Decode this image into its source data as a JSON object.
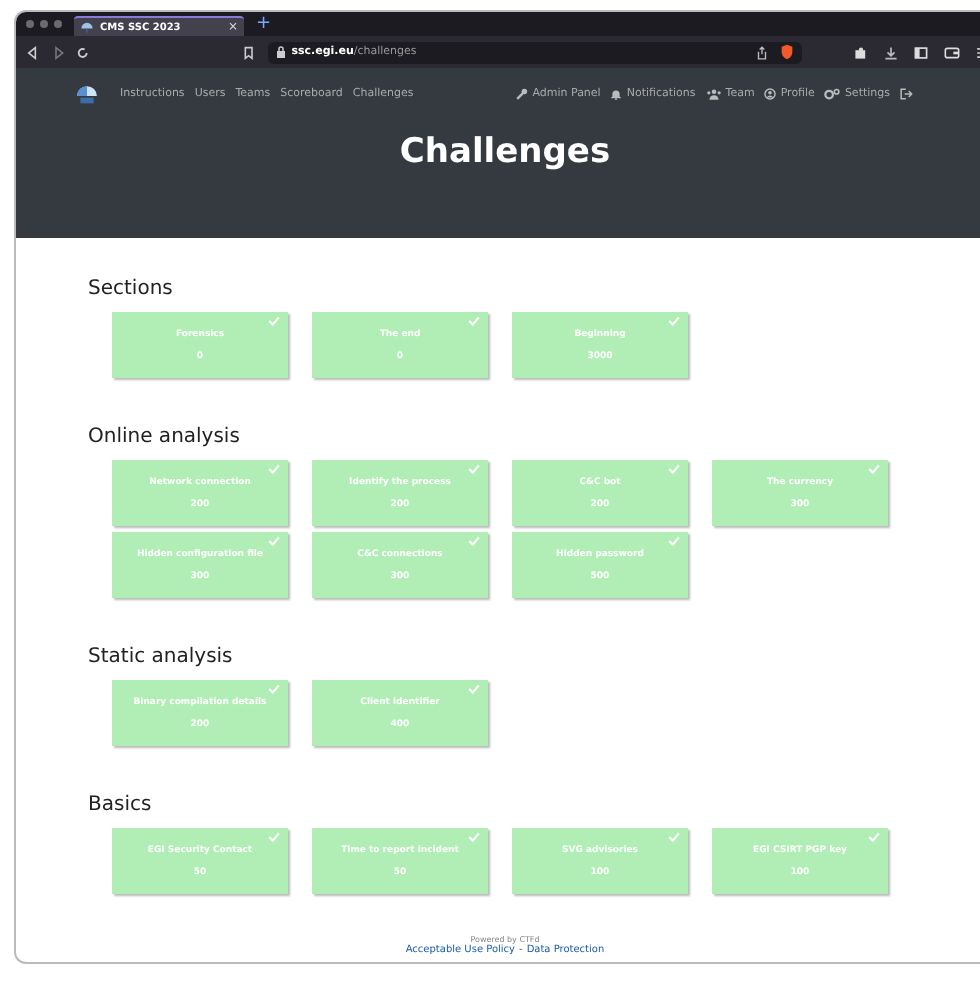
{
  "browser": {
    "tab": {
      "title": "CMS SSC 2023",
      "close": "×"
    },
    "new_tab": "+",
    "url": {
      "host": "ssc.egi.eu",
      "path": "/challenges"
    }
  },
  "nav": {
    "left": [
      "Instructions",
      "Users",
      "Teams",
      "Scoreboard",
      "Challenges"
    ],
    "right": [
      {
        "kind": "wrench",
        "label": "Admin Panel"
      },
      {
        "kind": "bell",
        "label": "Notifications"
      },
      {
        "kind": "users",
        "label": "Team"
      },
      {
        "kind": "user",
        "label": "Profile"
      },
      {
        "kind": "gears",
        "label": "Settings"
      },
      {
        "kind": "logout"
      }
    ]
  },
  "page_title": "Challenges",
  "categories": [
    {
      "name": "Sections",
      "challenges": [
        {
          "name": "Forensics",
          "points": "0",
          "solved": true
        },
        {
          "name": "The end",
          "points": "0",
          "solved": true
        },
        {
          "name": "Beginning",
          "points": "3000",
          "solved": true
        }
      ]
    },
    {
      "name": "Online analysis",
      "challenges": [
        {
          "name": "Network connection",
          "points": "200",
          "solved": true
        },
        {
          "name": "Identify the process",
          "points": "200",
          "solved": true
        },
        {
          "name": "C&C bot",
          "points": "200",
          "solved": true
        },
        {
          "name": "The currency",
          "points": "300",
          "solved": true
        },
        {
          "name": "Hidden configuration file",
          "points": "300",
          "solved": true
        },
        {
          "name": "C&C connections",
          "points": "300",
          "solved": true
        },
        {
          "name": "Hidden password",
          "points": "500",
          "solved": true
        }
      ]
    },
    {
      "name": "Static analysis",
      "challenges": [
        {
          "name": "Binary compilation details",
          "points": "200",
          "solved": true
        },
        {
          "name": "Client identifier",
          "points": "400",
          "solved": true
        }
      ]
    },
    {
      "name": "Basics",
      "challenges": [
        {
          "name": "EGI Security Contact",
          "points": "50",
          "solved": true
        },
        {
          "name": "Time to report incident",
          "points": "50",
          "solved": true
        },
        {
          "name": "SVG advisories",
          "points": "100",
          "solved": true
        },
        {
          "name": "EGI CSIRT PGP key",
          "points": "100",
          "solved": true
        }
      ]
    }
  ],
  "footer": {
    "powered": "Powered by CTFd",
    "links": [
      "Acceptable Use Policy",
      "Data Protection"
    ],
    "separator": "-"
  }
}
